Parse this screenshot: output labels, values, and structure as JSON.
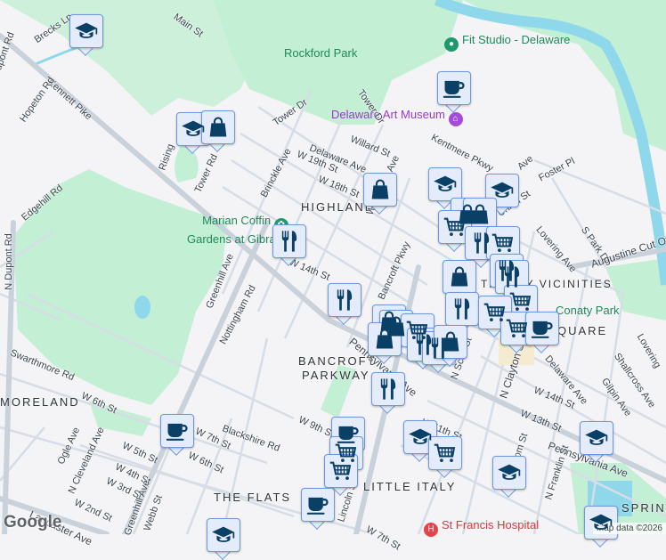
{
  "neighborhoods": [
    "HIGHLANDS",
    "BANCROFT",
    "PARKWAY",
    "MORELAND",
    "THE FLATS",
    "LITTLE ITALY",
    "TRINITY VICINITIES",
    "QUARE",
    "SPRING"
  ],
  "pois": {
    "fit_studio": "Fit Studio - Delaware",
    "rockford_park": "Rockford Park",
    "art_museum": "Delaware Art Museum",
    "marian_coffin_1": "Marian Coffin",
    "marian_coffin_2": "Gardens at Gibraltar",
    "conaty_park": "Conaty Park",
    "st_francis": "St Francis Hospital"
  },
  "streets": {
    "main_st": "Main St",
    "brecks_ln": "Brecks Ln",
    "dupont_rd": "Dupont Rd",
    "kennett_pike": "Kennett Pike",
    "hopeton_rd": "Hopeton Rd",
    "edgehill_rd": "Edgehill Rd",
    "n_dupont_rd": "N Dupont Rd",
    "rising": "Rising",
    "tower_rd": "Tower Rd",
    "tower_dr": "Tower Dr",
    "tower_dr2": "Tower Dr",
    "brinckle_ave": "Brinckle Ave",
    "delaware_ave": "Delaware Ave",
    "w19th": "W 19th St",
    "w18th": "W 18th St",
    "willard_st": "Willard St",
    "kentmere_pkwy": "Kentmere Pkwy",
    "woodlawn_ave": "Woodlawn Ave",
    "foster_pl": "Foster Pl",
    "rodney_ave": "Ave",
    "union_st": "Union St",
    "lovering_ave": "Lovering Ave",
    "s_park_dr": "S Park Dr",
    "augustine": "Augustine Cut Off",
    "bancroft_pkwy": "Bancroft Pkwy",
    "w14th_a": "W 14th St",
    "greenhill_ave": "Greenhill Ave",
    "nottingham_rd": "Nottingham Rd",
    "swarthmore_rd": "Swarthmore Rd",
    "w6th": "W 6th St",
    "w9th": "W 9th St",
    "blackshire_rd": "Blackshire Rd",
    "w7th": "W 7th St",
    "w6th_b": "W 6th St",
    "w5th": "W 5th St",
    "w4th": "W 4th St",
    "w3rd": "W 3rd St",
    "w2nd": "W 2nd St",
    "ogle_ave": "Ogle Ave",
    "n_cleveland_ave": "N Cleveland Ave",
    "lancaster_ave": "Lancaster Ave",
    "greenhill_ave2": "Greenhill Ave",
    "webb_st": "Webb St",
    "pennsylvania_ave": "Pennsylvania Ave",
    "pennsylvania_ave2": "Pennsylvania Ave",
    "n_scott_st": "N Scott St",
    "n_clayton_st": "N Clayton St",
    "delaware_ave2": "Delaware Ave",
    "w14th": "W 14th St",
    "w13th": "W 13th St",
    "gilpin_ave": "Gilpin Ave",
    "shallcross_ave": "Shallcross Ave",
    "lovering2": "Lovering",
    "w11th": "W 11th St",
    "n_broom_st": "N Broom St",
    "n_franklin_st": "N Franklin St",
    "lincoln_st": "Lincoln St",
    "w7th_b": "W 7th St"
  },
  "markers": [
    "school",
    "school",
    "shopping",
    "food",
    "coffee",
    "shopping",
    "school",
    "school",
    "shopping",
    "shopping",
    "cart",
    "food",
    "cart",
    "shopping",
    "food",
    "food",
    "cart",
    "food",
    "food",
    "cart",
    "cart",
    "coffee",
    "shopping",
    "shopping",
    "cart",
    "food",
    "food",
    "shopping",
    "shopping",
    "food",
    "coffee",
    "coffee",
    "cart",
    "cart",
    "school",
    "cart",
    "school",
    "school",
    "coffee",
    "school",
    "school"
  ],
  "footer": {
    "logo": "Google",
    "attribution": "Map data ©2026"
  },
  "colors": {
    "park": "#c3efd5",
    "water": "#8fd8ec",
    "marker_bg": "#e4ecfb",
    "marker_border": "#6c98e0",
    "icon": "#0b4066"
  }
}
